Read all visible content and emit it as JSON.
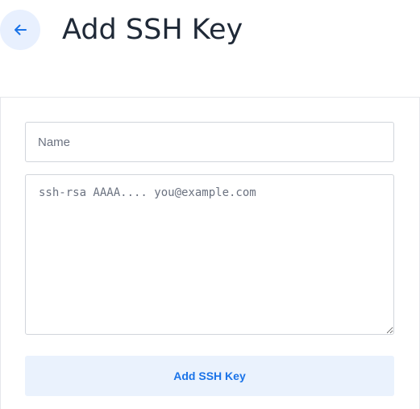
{
  "header": {
    "title": "Add SSH Key",
    "back_icon": "arrow-left-icon"
  },
  "form": {
    "name_placeholder": "Name",
    "name_value": "",
    "key_placeholder": "ssh-rsa AAAA.... you@example.com",
    "key_value": "",
    "submit_label": "Add SSH Key"
  },
  "colors": {
    "accent": "#1a73e8",
    "accent_bg": "#eaf2fd",
    "title_text": "#1f2937",
    "border": "#d1d5db"
  }
}
